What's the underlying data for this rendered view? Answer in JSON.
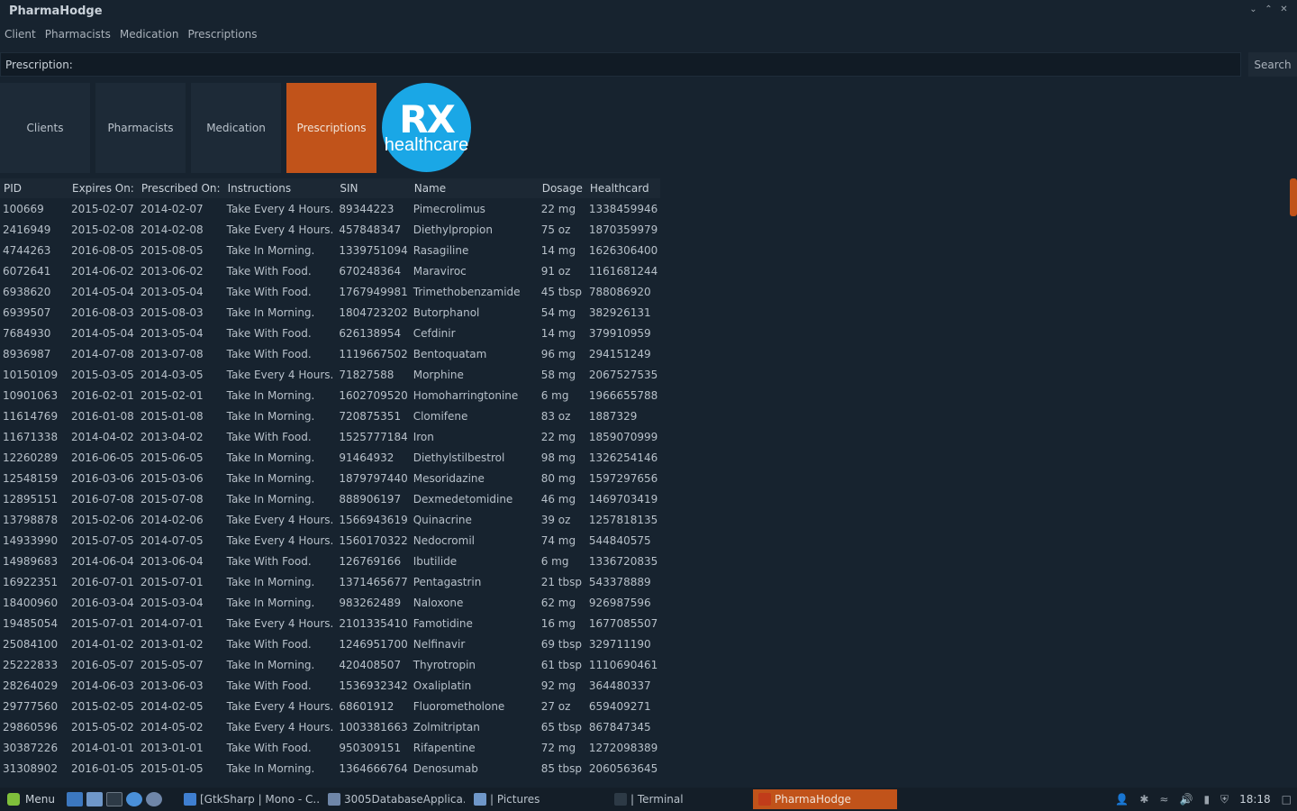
{
  "window": {
    "title": "PharmaHodge",
    "controls": [
      "⌄",
      "⌃",
      "✕"
    ]
  },
  "menu": [
    "Client",
    "Pharmacists",
    "Medication",
    "Prescriptions"
  ],
  "search": {
    "label": "Prescription:",
    "value": "",
    "button": "Search"
  },
  "tiles": [
    {
      "label": "Clients",
      "active": false
    },
    {
      "label": "Pharmacists",
      "active": false
    },
    {
      "label": "Medication",
      "active": false
    },
    {
      "label": "Prescriptions",
      "active": true
    }
  ],
  "logo": {
    "line1": "RX",
    "line2": "healthcare"
  },
  "table": {
    "columns": [
      "PID",
      "Expires On:",
      "Prescribed On:",
      "Instructions",
      "SIN",
      "Name",
      "Dosage",
      "Healthcard"
    ],
    "rows": [
      [
        "100669",
        "2015-02-07",
        "2014-02-07",
        "Take Every 4 Hours.",
        "89344223",
        "Pimecrolimus",
        "22 mg",
        "1338459946"
      ],
      [
        "2416949",
        "2015-02-08",
        "2014-02-08",
        "Take Every 4 Hours.",
        "457848347",
        "Diethylpropion",
        "75 oz",
        "1870359979"
      ],
      [
        "4744263",
        "2016-08-05",
        "2015-08-05",
        "Take In Morning.",
        "1339751094",
        "Rasagiline",
        "14 mg",
        "1626306400"
      ],
      [
        "6072641",
        "2014-06-02",
        "2013-06-02",
        "Take With Food.",
        "670248364",
        "Maraviroc",
        "91 oz",
        "1161681244"
      ],
      [
        "6938620",
        "2014-05-04",
        "2013-05-04",
        "Take With Food.",
        "1767949981",
        "Trimethobenzamide",
        "45 tbsp",
        "788086920"
      ],
      [
        "6939507",
        "2016-08-03",
        "2015-08-03",
        "Take In Morning.",
        "1804723202",
        "Butorphanol",
        "54 mg",
        "382926131"
      ],
      [
        "7684930",
        "2014-05-04",
        "2013-05-04",
        "Take With Food.",
        "626138954",
        "Cefdinir",
        "14 mg",
        "379910959"
      ],
      [
        "8936987",
        "2014-07-08",
        "2013-07-08",
        "Take With Food.",
        "1119667502",
        "Bentoquatam",
        "96 mg",
        "294151249"
      ],
      [
        "10150109",
        "2015-03-05",
        "2014-03-05",
        "Take Every 4 Hours.",
        "71827588",
        "Morphine",
        "58 mg",
        "2067527535"
      ],
      [
        "10901063",
        "2016-02-01",
        "2015-02-01",
        "Take In Morning.",
        "1602709520",
        "Homoharringtonine",
        "6 mg",
        "1966655788"
      ],
      [
        "11614769",
        "2016-01-08",
        "2015-01-08",
        "Take In Morning.",
        "720875351",
        "Clomifene",
        "83 oz",
        "1887329"
      ],
      [
        "11671338",
        "2014-04-02",
        "2013-04-02",
        "Take With Food.",
        "1525777184",
        "Iron",
        "22 mg",
        "1859070999"
      ],
      [
        "12260289",
        "2016-06-05",
        "2015-06-05",
        "Take In Morning.",
        "91464932",
        "Diethylstilbestrol",
        "98 mg",
        "1326254146"
      ],
      [
        "12548159",
        "2016-03-06",
        "2015-03-06",
        "Take In Morning.",
        "1879797440",
        "Mesoridazine",
        "80 mg",
        "1597297656"
      ],
      [
        "12895151",
        "2016-07-08",
        "2015-07-08",
        "Take In Morning.",
        "888906197",
        "Dexmedetomidine",
        "46 mg",
        "1469703419"
      ],
      [
        "13798878",
        "2015-02-06",
        "2014-02-06",
        "Take Every 4 Hours.",
        "1566943619",
        "Quinacrine",
        "39 oz",
        "1257818135"
      ],
      [
        "14933990",
        "2015-07-05",
        "2014-07-05",
        "Take Every 4 Hours.",
        "1560170322",
        "Nedocromil",
        "74 mg",
        "544840575"
      ],
      [
        "14989683",
        "2014-06-04",
        "2013-06-04",
        "Take With Food.",
        "126769166",
        "Ibutilide",
        "6 mg",
        "1336720835"
      ],
      [
        "16922351",
        "2016-07-01",
        "2015-07-01",
        "Take In Morning.",
        "1371465677",
        "Pentagastrin",
        "21 tbsp",
        "543378889"
      ],
      [
        "18400960",
        "2016-03-04",
        "2015-03-04",
        "Take In Morning.",
        "983262489",
        "Naloxone",
        "62 mg",
        "926987596"
      ],
      [
        "19485054",
        "2015-07-01",
        "2014-07-01",
        "Take Every 4 Hours.",
        "2101335410",
        "Famotidine",
        "16 mg",
        "1677085507"
      ],
      [
        "25084100",
        "2014-01-02",
        "2013-01-02",
        "Take With Food.",
        "1246951700",
        "Nelfinavir",
        "69 tbsp",
        "329711190"
      ],
      [
        "25222833",
        "2016-05-07",
        "2015-05-07",
        "Take In Morning.",
        "420408507",
        "Thyrotropin",
        "61 tbsp",
        "1110690461"
      ],
      [
        "28264029",
        "2014-06-03",
        "2013-06-03",
        "Take With Food.",
        "1536932342",
        "Oxaliplatin",
        "92 mg",
        "364480337"
      ],
      [
        "29777560",
        "2015-02-05",
        "2014-02-05",
        "Take Every 4 Hours.",
        "68601912",
        "Fluorometholone",
        "27 oz",
        "659409271"
      ],
      [
        "29860596",
        "2015-05-02",
        "2014-05-02",
        "Take Every 4 Hours.",
        "1003381663",
        "Zolmitriptan",
        "65 tbsp",
        "867847345"
      ],
      [
        "30387226",
        "2014-01-01",
        "2013-01-01",
        "Take With Food.",
        "950309151",
        "Rifapentine",
        "72 mg",
        "1272098389"
      ],
      [
        "31308902",
        "2016-01-05",
        "2015-01-05",
        "Take In Morning.",
        "1364666764",
        "Denosumab",
        "85 tbsp",
        "2060563645"
      ]
    ]
  },
  "taskbar": {
    "menu_label": "Menu",
    "tasks": [
      {
        "label": "[GtkSharp | Mono - C...",
        "active": false,
        "color": "#3f7fd1"
      },
      {
        "label": "3005DatabaseApplica...",
        "active": false,
        "color": "#6f86a8"
      },
      {
        "label": "| Pictures",
        "active": false,
        "color": "#6f97c9"
      },
      {
        "label": "| Terminal",
        "active": false,
        "color": "#2d3a46"
      },
      {
        "label": "PharmaHodge",
        "active": true,
        "color": "#c13c1a"
      }
    ],
    "tray_icons": [
      "user-icon",
      "bluetooth-icon",
      "wifi-icon",
      "volume-icon",
      "clipboard-icon",
      "shield-icon"
    ],
    "clock": "18:18"
  },
  "colors": {
    "accent": "#c1531a",
    "background": "#17232f",
    "logo": "#1aa7e6"
  }
}
